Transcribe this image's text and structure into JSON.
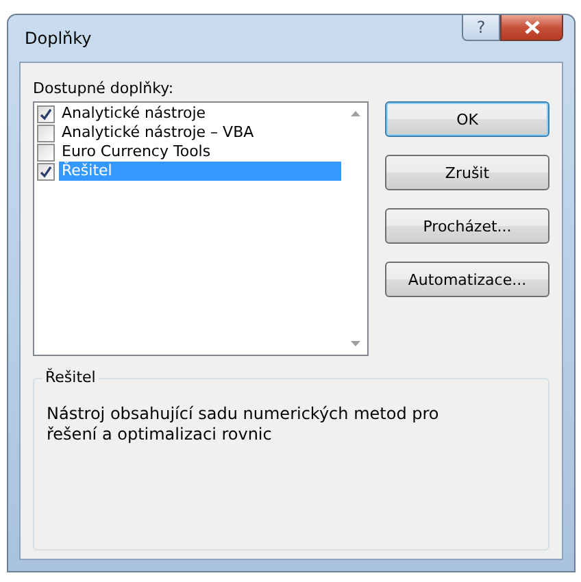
{
  "window": {
    "title": "Doplňky",
    "help_button": "?"
  },
  "addins": {
    "label": "Dostupné doplňky:",
    "items": [
      {
        "label": "Analytické nástroje",
        "checked": true,
        "selected": false
      },
      {
        "label": "Analytické nástroje – VBA",
        "checked": false,
        "selected": false
      },
      {
        "label": "Euro Currency Tools",
        "checked": false,
        "selected": false
      },
      {
        "label": "Řešitel",
        "checked": true,
        "selected": true
      }
    ]
  },
  "buttons": [
    {
      "label": "OK",
      "default": true
    },
    {
      "label": "Zrušit",
      "default": false
    },
    {
      "label": "Procházet...",
      "default": false
    },
    {
      "label": "Automatizace...",
      "default": false
    }
  ],
  "description": {
    "title": "Řešitel",
    "text": "Nástroj obsahující sadu numerických metod pro řešení a optimalizaci rovnic"
  }
}
